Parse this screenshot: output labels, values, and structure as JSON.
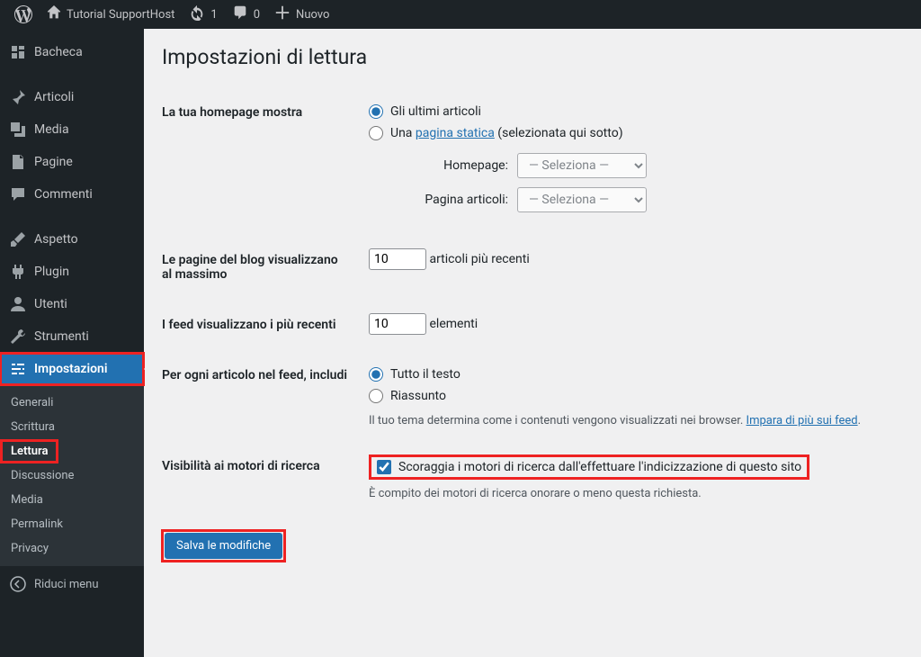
{
  "toolbar": {
    "site_name": "Tutorial SupportHost",
    "updates": "1",
    "comments": "0",
    "new": "Nuovo"
  },
  "sidebar": {
    "items": [
      {
        "label": "Bacheca"
      },
      {
        "label": "Articoli"
      },
      {
        "label": "Media"
      },
      {
        "label": "Pagine"
      },
      {
        "label": "Commenti"
      },
      {
        "label": "Aspetto"
      },
      {
        "label": "Plugin"
      },
      {
        "label": "Utenti"
      },
      {
        "label": "Strumenti"
      },
      {
        "label": "Impostazioni"
      }
    ],
    "submenu": [
      {
        "label": "Generali"
      },
      {
        "label": "Scrittura"
      },
      {
        "label": "Lettura"
      },
      {
        "label": "Discussione"
      },
      {
        "label": "Media"
      },
      {
        "label": "Permalink"
      },
      {
        "label": "Privacy"
      }
    ],
    "collapse": "Riduci menu"
  },
  "page_title": "Impostazioni di lettura",
  "form": {
    "homepage_label": "La tua homepage mostra",
    "homepage_opt1": "Gli ultimi articoli",
    "homepage_opt2_prefix": "Una ",
    "homepage_opt2_link": "pagina statica",
    "homepage_opt2_suffix": " (selezionata qui sotto)",
    "homepage_select_label": "Homepage:",
    "posts_page_select_label": "Pagina articoli:",
    "select_placeholder": "— Seleziona —",
    "blog_pages_label": "Le pagine del blog visualizzano al massimo",
    "blog_pages_value": 10,
    "blog_pages_suffix": "articoli più recenti",
    "feed_items_label": "I feed visualizzano i più recenti",
    "feed_items_value": 10,
    "feed_items_suffix": "elementi",
    "feed_content_label": "Per ogni articolo nel feed, includi",
    "feed_content_opt1": "Tutto il testo",
    "feed_content_opt2": "Riassunto",
    "feed_desc_prefix": "Il tuo tema determina come i contenuti vengono visualizzati nei browser. ",
    "feed_desc_link": "Impara di più sui feed",
    "visibility_label": "Visibilità ai motori di ricerca",
    "visibility_check": "Scoraggia i motori di ricerca dall'effettuare l'indicizzazione di questo sito",
    "visibility_desc": "È compito dei motori di ricerca onorare o meno questa richiesta.",
    "submit": "Salva le modifiche"
  }
}
